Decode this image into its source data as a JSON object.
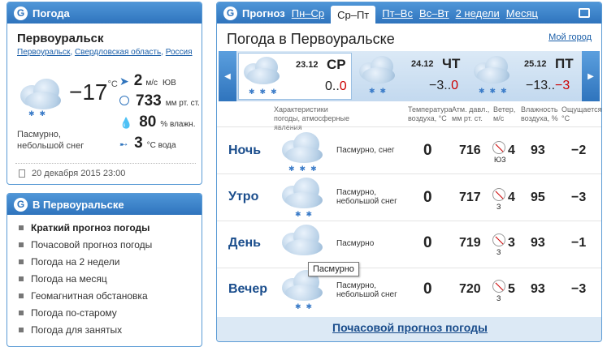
{
  "current": {
    "header": "Погода",
    "city": "Первоуральск",
    "breadcrumb": [
      "Первоуральск",
      "Свердловская область",
      "Россия"
    ],
    "temp": "−17",
    "temp_unit": "°С",
    "wind_speed": "2",
    "wind_unit": "м/с",
    "wind_dir": "ЮВ",
    "pressure": "733",
    "pressure_unit": "мм рт. ст.",
    "humidity": "80",
    "humidity_unit": "% влажн.",
    "water": "3",
    "water_unit": "°С вода",
    "description": "Пасмурно, небольшой снег",
    "datetime": "20 декабря 2015 23:00"
  },
  "menu": {
    "header": "В Первоуральске",
    "items": [
      "Краткий прогноз погоды",
      "Почасовой прогноз погоды",
      "Погода на 2 недели",
      "Погода на месяц",
      "Геомагнитная обстановка",
      "Погода по-старому",
      "Погода для занятых"
    ]
  },
  "forecast": {
    "tabs": [
      "Прогноз",
      "Пн–Ср",
      "Ср–Пт",
      "Пт–Вс",
      "Вс–Вт",
      "2 недели",
      "Месяц"
    ],
    "title": "Погода в Первоуральске",
    "my_city": "Мой город",
    "days": [
      {
        "date": "23.12",
        "dow": "СР",
        "temps": "0..",
        "temps_red": "0"
      },
      {
        "date": "24.12",
        "dow": "ЧТ",
        "temps": "−3..",
        "temps_red": "0"
      },
      {
        "date": "25.12",
        "dow": "ПТ",
        "temps": "−13..",
        "temps_red": "−3"
      }
    ],
    "headers": {
      "conditions": "Характеристики погоды, атмосферные явления",
      "temp": "Температура воздуха, °С",
      "pressure": "Атм. давл., мм рт. ст.",
      "wind": "Ветер, м/с",
      "humidity": "Влажность воздуха, %",
      "feels": "Ощущается, °С"
    },
    "rows": [
      {
        "period": "Ночь",
        "desc": "Пасмурно, снег",
        "temp": "0",
        "pressure": "716",
        "wind": "4",
        "wind_dir": "ЮЗ",
        "humidity": "93",
        "feels": "−2"
      },
      {
        "period": "Утро",
        "desc": "Пасмурно, небольшой снег",
        "temp": "0",
        "pressure": "717",
        "wind": "4",
        "wind_dir": "З",
        "humidity": "95",
        "feels": "−3"
      },
      {
        "period": "День",
        "desc": "Пасмурно",
        "temp": "0",
        "pressure": "719",
        "wind": "3",
        "wind_dir": "З",
        "humidity": "93",
        "feels": "−1"
      },
      {
        "period": "Вечер",
        "desc": "Пасмурно, небольшой снег",
        "temp": "0",
        "pressure": "720",
        "wind": "5",
        "wind_dir": "З",
        "humidity": "93",
        "feels": "−3"
      }
    ],
    "tooltip": "Пасмурно",
    "footer_link": "Почасовой прогноз погоды"
  }
}
